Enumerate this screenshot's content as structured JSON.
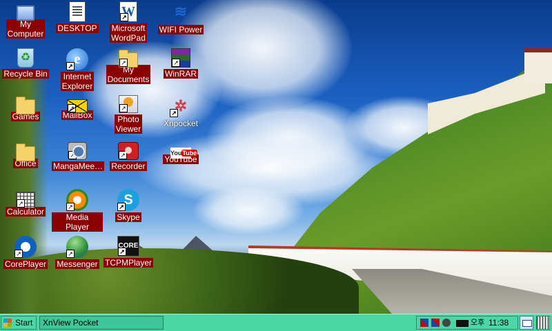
{
  "desktop": {
    "icons": [
      {
        "label": "My\nComputer",
        "icon": "computer-icon"
      },
      {
        "label": "DESKTOP",
        "icon": "document-icon"
      },
      {
        "label": "Microsoft\nWordPad",
        "icon": "wordpad-icon"
      },
      {
        "label": "WIFI Power",
        "icon": "wifi-icon"
      },
      {
        "label": "Recycle Bin",
        "icon": "recycle-bin-icon"
      },
      {
        "label": "Internet\nExplorer",
        "icon": "internet-explorer-icon"
      },
      {
        "label": "My\nDocuments",
        "icon": "folder-icon"
      },
      {
        "label": "WinRAR",
        "icon": "winrar-icon"
      },
      {
        "label": "Games",
        "icon": "folder-icon"
      },
      {
        "label": "MailBox",
        "icon": "mail-icon"
      },
      {
        "label": "Photo\nViewer",
        "icon": "photo-viewer-icon"
      },
      {
        "label": "Xnpocket",
        "icon": "xnpocket-icon"
      },
      {
        "label": "Office",
        "icon": "folder-icon"
      },
      {
        "label": "MangaMee…",
        "icon": "manga-reader-icon"
      },
      {
        "label": "Recorder",
        "icon": "recorder-icon"
      },
      {
        "label": "YouTube",
        "icon": "youtube-icon"
      },
      {
        "label": "Calculator",
        "icon": "calculator-icon"
      },
      {
        "label": "Media Player",
        "icon": "media-player-icon"
      },
      {
        "label": "Skype",
        "icon": "skype-icon"
      },
      {
        "label": "CorePlayer",
        "icon": "coreplayer-icon"
      },
      {
        "label": "Messenger",
        "icon": "messenger-icon"
      },
      {
        "label": "TCPMPlayer",
        "icon": "tcpmplayer-icon"
      }
    ],
    "label_bg_color": "#8b0000"
  },
  "taskbar": {
    "start_label": "Start",
    "active_task": "XnView Pocket",
    "tray": {
      "lang": "오후",
      "time": "11:38"
    },
    "accent_color": "#4cd6a6"
  }
}
